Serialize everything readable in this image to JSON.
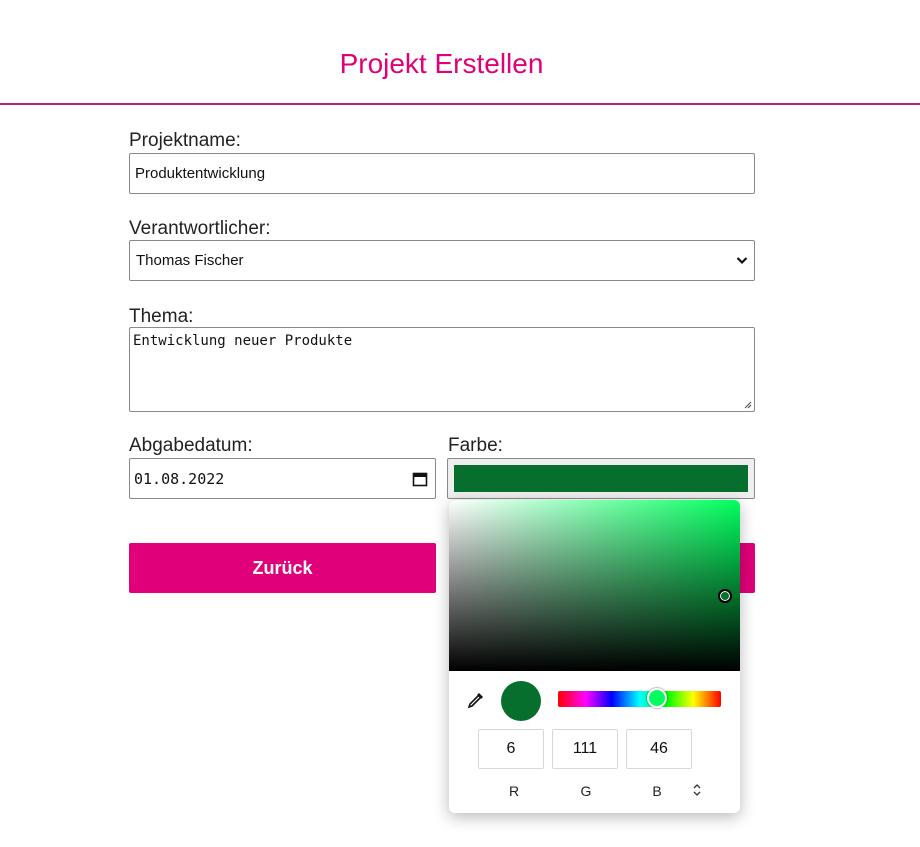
{
  "header": {
    "title": "Projekt Erstellen"
  },
  "form": {
    "projektname": {
      "label": "Projektname:",
      "value": "Produktentwicklung"
    },
    "verantwortlicher": {
      "label": "Verantwortlicher:",
      "selected": "Thomas Fischer"
    },
    "thema": {
      "label": "Thema:",
      "value": "Entwicklung neuer Produkte"
    },
    "abgabedatum": {
      "label": "Abgabedatum:",
      "value": "01.08.2022"
    },
    "farbe": {
      "label": "Farbe:",
      "value": "#066f2e"
    }
  },
  "buttons": {
    "back_label": "Zurück"
  },
  "color_picker": {
    "r": "6",
    "g": "111",
    "b": "46",
    "r_label": "R",
    "g_label": "G",
    "b_label": "B",
    "hue_degrees": 142,
    "saturation": 0.95,
    "value": 0.44
  },
  "colors": {
    "accent": "#e0007a",
    "divider": "#c2217b",
    "selected_color": "#066f2e"
  }
}
